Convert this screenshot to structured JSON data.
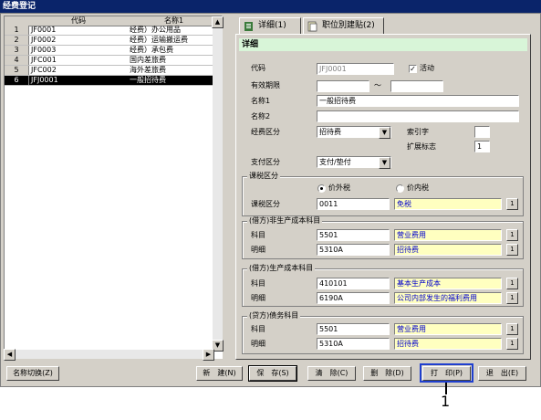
{
  "window": {
    "title": "经费登记"
  },
  "list": {
    "headers": [
      "",
      "代码",
      "名称1"
    ],
    "rows": [
      {
        "no": "1",
        "code": "JF0001",
        "name": "经费）办公用品",
        "selected": false
      },
      {
        "no": "2",
        "code": "JF0002",
        "name": "经费）运输搬运费",
        "selected": false
      },
      {
        "no": "3",
        "code": "JF0003",
        "name": "经费）承包费",
        "selected": false
      },
      {
        "no": "4",
        "code": "JFC001",
        "name": "国内差旅费",
        "selected": false
      },
      {
        "no": "5",
        "code": "JFC002",
        "name": "海外差旅费",
        "selected": false
      },
      {
        "no": "6",
        "code": "JFJ0001",
        "name": "一般招待费",
        "selected": true
      }
    ]
  },
  "tabs": [
    {
      "label": "详细(1)",
      "active": true,
      "icon": "detail-icon"
    },
    {
      "label": "职位別建贴(2)",
      "active": false,
      "icon": "document-icon"
    }
  ],
  "detail": {
    "header": "详细",
    "code_label": "代码",
    "code_value": "JFJ0001",
    "active_label": "活动",
    "active_checked": true,
    "period_label": "有效期限",
    "period_sep": "～",
    "name1_label": "名称1",
    "name1_value": "一般招待费",
    "name2_label": "名称2",
    "name2_value": "",
    "expense_type_label": "经费区分",
    "expense_type_value": "招待费",
    "index_label": "索引字",
    "index_value": "",
    "ext_flag_label": "扩展标志",
    "ext_flag_value": "1",
    "payment_type_label": "支付区分",
    "payment_type_value": "支付/垫付",
    "tax_group_title": "课税区分",
    "tax_option_outside": "价外税",
    "tax_option_inside": "价内税",
    "tax_type_label": "课税区分",
    "tax_type_code": "0011",
    "tax_type_name": "免税",
    "debit_group_title": "(借方)非生产成本科目",
    "debit_account_label": "科目",
    "debit_account_code": "5501",
    "debit_account_name": "营业费用",
    "debit_detail_label": "明细",
    "debit_detail_code": "5310A",
    "debit_detail_name": "招待费",
    "prod_group_title": "(借方)生产成本科目",
    "prod_account_label": "科目",
    "prod_account_code": "410101",
    "prod_account_name": "基本生产成本",
    "prod_detail_label": "明细",
    "prod_detail_code": "6190A",
    "prod_detail_name": "公司内部发生的福利费用",
    "credit_group_title": "(贷方)债务科目",
    "credit_account_label": "科目",
    "credit_account_code": "5501",
    "credit_account_name": "营业费用",
    "credit_detail_label": "明细",
    "credit_detail_code": "5310A",
    "credit_detail_name": "招待费",
    "lookup_glyph": "1"
  },
  "buttons": {
    "name_switch": "名称切换(Z)",
    "new": "新　建(N)",
    "save": "保　存(S)",
    "clear": "清　除(C)",
    "delete": "删　除(D)",
    "print": "打　印(P)",
    "exit": "退　出(E)"
  },
  "callout": {
    "number": "1",
    "color": "#1f3fcf"
  }
}
